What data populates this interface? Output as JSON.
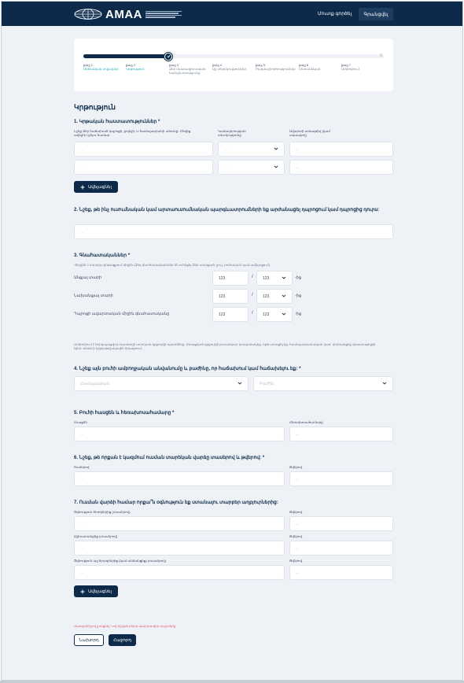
{
  "header": {
    "logo_text": "AMAA",
    "login": "Մուտք գործել",
    "register": "Գրանցվել"
  },
  "stepper": {
    "progress_percent": 29,
    "end_label": "0",
    "steps": [
      {
        "num": "քայլ 1",
        "title": "Անձնական տվյալներ"
      },
      {
        "num": "քայլ 2",
        "title": "Կրթություն"
      },
      {
        "num": "քայլ 3",
        "title": "Ձեր մասնագիտական նախընտրությունը"
      },
      {
        "num": "քայլ 4",
        "title": "Այլ տեղեկություններ"
      },
      {
        "num": "քայլ 5",
        "title": "Բազմաշնորհություններ"
      },
      {
        "num": "քայլ 6",
        "title": "Ընտանեկան"
      },
      {
        "num": "քայլ 7",
        "title": "Ամփոփում"
      }
    ]
  },
  "section_title": "Կրթություն",
  "q1": {
    "title": "1. Կրթական հաստատություններ *",
    "col1_label": "Նշեք Ձեր հաճախած դպրոցի, քոլեջի, և համալսարանի անունը։ Մեկից ավելին նշելու համար.",
    "col2_label": "Կամավորության տևողությունը",
    "col3_label": "Ավարտի ամսաթիվ (կամ սպասվող)",
    "placeholder": "...",
    "add_label": "Ավելացնել"
  },
  "q2": {
    "title": "2. Նշեք, թե ինչ ուսումնական կամ արտաուսումնական պարգևատրումների եք արժանացել դպրոցում կամ դպրոցից դուրս:",
    "placeholder": "..."
  },
  "q3": {
    "title": "3. Գնահատականներ *",
    "hint": "Վերջին 2 տարվա ընթացքում միջին (Ձեզ գնահատականներ են ունեցել Ձեր ստացած, ջուլ, բուհական կամ ավելացում)",
    "rows": [
      {
        "label": "Անցյալ տարի",
        "value": "123",
        "scale": "123",
        "unit": "-ից"
      },
      {
        "label": "Նախանցյալ տարի",
        "value": "123",
        "scale": "123",
        "unit": "-ից"
      },
      {
        "label": "Դպրոցի ավարտական միջին գնահատականը",
        "value": "123",
        "scale": "123",
        "unit": "-ից"
      }
    ]
  },
  "note": "Ամփոփում է ներկայացվող ուսանողի ստորյան գրքույկի պատճենը: Ստացված գրքույկի լուսանկար կապանակեք, եթե ստացել եք, համալսարանական կամ, փոխանցեք փաստաթղթի էջեր: AMAA-ի կրթաթոշակային ծրագրում:",
  "q4": {
    "title": "4. Նշեք այն բուհի ամբողջական անվանումը և բաժինը, որ հաճախում կամ հաճախելու եք: *",
    "university_placeholder": "Համալսարան",
    "faculty_placeholder": "Բաժին"
  },
  "q5": {
    "title": "5. Բուհի հասցեն և հեռախոսահամարը *",
    "address_label": "Հասցեն",
    "phone_label": "Հեռախոսահամարը",
    "placeholder": "..."
  },
  "q6": {
    "title": "6. Նշեք, թե որքան է կազմում ուսման տարեկան վարձը տասերով և թվերով: *",
    "words_label": "Տառերով",
    "digits_label": "Թվերով",
    "placeholder": "..."
  },
  "q7": {
    "title": "7. Ուսման վարձի համար որքա՞ն օգնություն եք ստանալու տարբեր աղբյուրներից:",
    "rows": [
      {
        "label": "Օգնություն ծնողներից (տասերով)",
        "digits_label": "Թվերով"
      },
      {
        "label": "Աշխատանքից (տասերով)",
        "digits_label": "Թվերով"
      },
      {
        "label": "Օգնություն այլ ծրագրերից (կամ անձանցից) (տասերով)",
        "digits_label": "Թվերով"
      }
    ],
    "placeholder": "...",
    "add_label": "Ավելացնել"
  },
  "footer": {
    "required_note": "Աստղանիշով լրացնել *-ով նշված բոլոր պարտադիր դաշտերը",
    "back": "Նախորդ",
    "next": "Հաջորդ"
  }
}
